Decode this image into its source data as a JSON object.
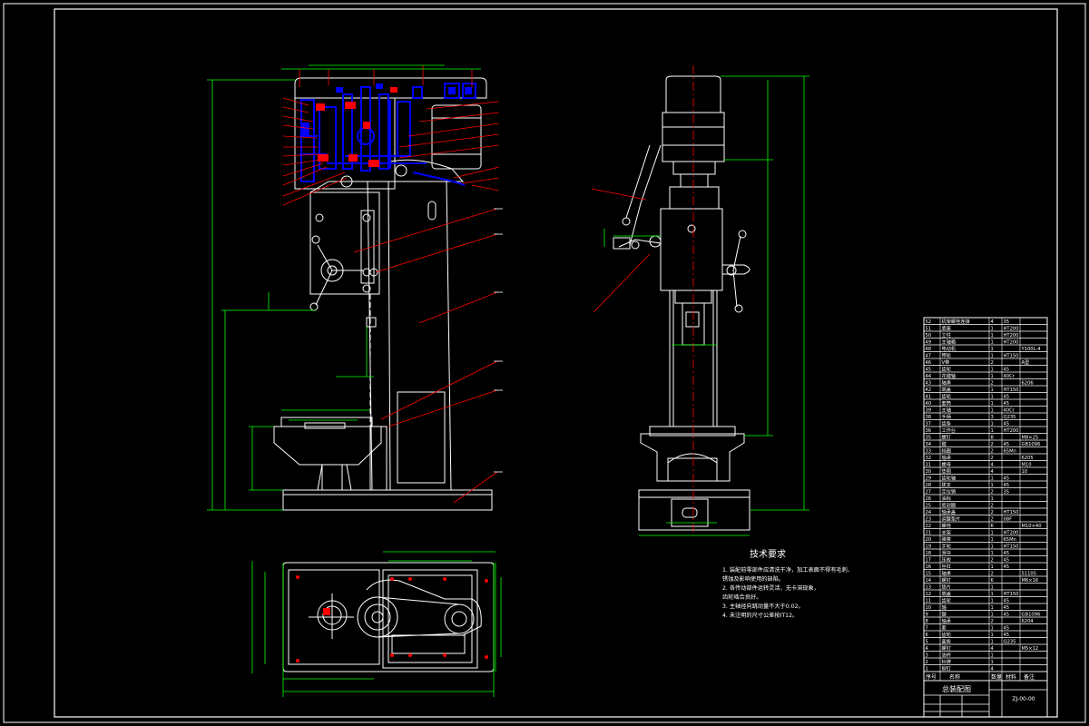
{
  "drawing": {
    "tech_req_title": "技术要求",
    "tech_req_items": [
      "1. 装配前零部件应清洗干净，加工表面不得有毛刺、",
      "   锈蚀及影响使用的缺陷。",
      "2. 各传动部件运转灵活，无卡滞现象，",
      "   齿轮啮合良好。",
      "3. 主轴径向跳动量不大于0.02。",
      "4. 未注明的尺寸公差按IT12。"
    ],
    "title_block": {
      "assembly_title": "总装配图",
      "drawing_no": "ZJ-00-00",
      "header": [
        "序号",
        "名称",
        "数量",
        "材料",
        "备注"
      ]
    },
    "bom_rows": [
      [
        "52",
        "机架螺栓连接",
        "4",
        "35",
        ""
      ],
      [
        "51",
        "底座",
        "1",
        "HT200",
        ""
      ],
      [
        "50",
        "立柱",
        "1",
        "HT200",
        ""
      ],
      [
        "49",
        "主轴箱",
        "1",
        "HT200",
        ""
      ],
      [
        "48",
        "电动机",
        "1",
        "",
        "Y100L-4"
      ],
      [
        "47",
        "带轮",
        "1",
        "HT150",
        ""
      ],
      [
        "46",
        "V带",
        "2",
        "",
        "A型"
      ],
      [
        "45",
        "齿轮",
        "1",
        "45",
        ""
      ],
      [
        "44",
        "花键轴",
        "1",
        "40Cr",
        ""
      ],
      [
        "43",
        "轴承",
        "2",
        "",
        "6206"
      ],
      [
        "42",
        "端盖",
        "1",
        "HT150",
        ""
      ],
      [
        "41",
        "齿轮",
        "1",
        "45",
        ""
      ],
      [
        "40",
        "套筒",
        "1",
        "45",
        ""
      ],
      [
        "39",
        "主轴",
        "1",
        "40Cr",
        ""
      ],
      [
        "38",
        "手柄",
        "3",
        "Q235",
        ""
      ],
      [
        "37",
        "齿条",
        "1",
        "45",
        ""
      ],
      [
        "36",
        "工作台",
        "1",
        "HT200",
        ""
      ],
      [
        "35",
        "螺钉",
        "8",
        "",
        "M8×25"
      ],
      [
        "34",
        "键",
        "2",
        "45",
        "GB1096"
      ],
      [
        "33",
        "挡圈",
        "2",
        "65Mn",
        ""
      ],
      [
        "32",
        "轴承",
        "2",
        "",
        "6205"
      ],
      [
        "31",
        "螺母",
        "4",
        "",
        "M10"
      ],
      [
        "30",
        "垫圈",
        "4",
        "",
        "10"
      ],
      [
        "29",
        "齿轮轴",
        "1",
        "45",
        ""
      ],
      [
        "28",
        "拨叉",
        "1",
        "45",
        ""
      ],
      [
        "27",
        "定位销",
        "2",
        "35",
        ""
      ],
      [
        "26",
        "油标",
        "1",
        "",
        ""
      ],
      [
        "25",
        "密封圈",
        "2",
        "",
        ""
      ],
      [
        "24",
        "轴承盖",
        "2",
        "HT150",
        ""
      ],
      [
        "23",
        "调整垫片",
        "2",
        "08F",
        ""
      ],
      [
        "22",
        "螺栓",
        "6",
        "",
        "M10×40"
      ],
      [
        "21",
        "支架",
        "1",
        "HT200",
        ""
      ],
      [
        "20",
        "弹簧",
        "1",
        "65Mn",
        ""
      ],
      [
        "19",
        "手轮",
        "1",
        "HT150",
        ""
      ],
      [
        "18",
        "滑块",
        "1",
        "45",
        ""
      ],
      [
        "17",
        "压板",
        "2",
        "45",
        ""
      ],
      [
        "16",
        "丝杠",
        "1",
        "45",
        ""
      ],
      [
        "15",
        "轴承",
        "2",
        "",
        "51105"
      ],
      [
        "14",
        "螺钉",
        "6",
        "",
        "M6×16"
      ],
      [
        "13",
        "垫片",
        "1",
        "",
        ""
      ],
      [
        "12",
        "端盖",
        "1",
        "HT150",
        ""
      ],
      [
        "11",
        "齿轮",
        "1",
        "45",
        ""
      ],
      [
        "10",
        "轴",
        "1",
        "45",
        ""
      ],
      [
        "9",
        "键",
        "1",
        "45",
        "GB1096"
      ],
      [
        "8",
        "轴承",
        "2",
        "",
        "6204"
      ],
      [
        "7",
        "套",
        "1",
        "45",
        ""
      ],
      [
        "6",
        "齿轮",
        "1",
        "45",
        ""
      ],
      [
        "5",
        "盖板",
        "1",
        "Q235",
        ""
      ],
      [
        "4",
        "螺钉",
        "4",
        "",
        "M5×12"
      ],
      [
        "3",
        "油杯",
        "1",
        "",
        ""
      ],
      [
        "2",
        "标牌",
        "1",
        "",
        ""
      ],
      [
        "1",
        "铆钉",
        "4",
        "",
        ""
      ]
    ]
  },
  "colors": {
    "background": "#000000",
    "outline": "#ffffff",
    "dimension": "#00ff00",
    "leader": "#ff0000",
    "section": "#0000ff"
  }
}
